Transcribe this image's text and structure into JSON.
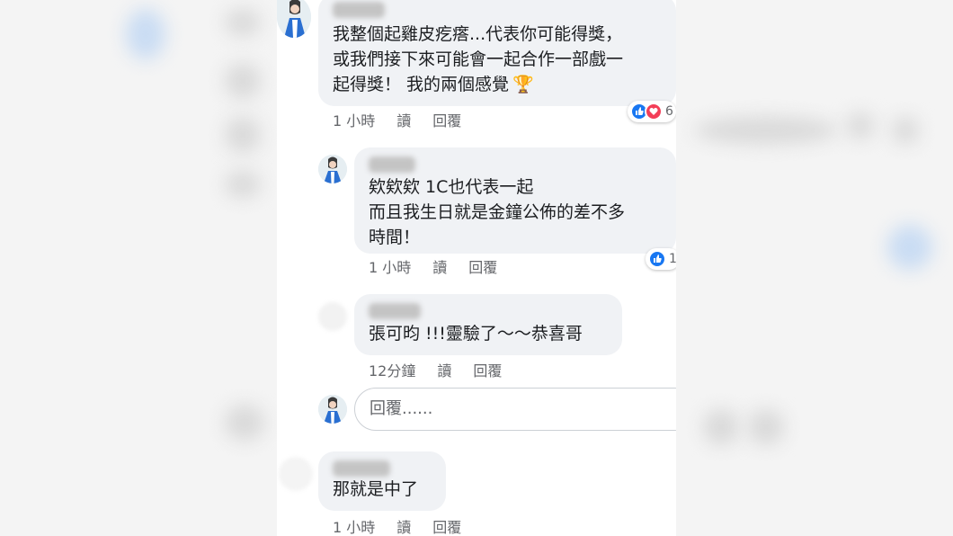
{
  "comments": [
    {
      "text_lines": [
        "我整個起雞皮疙瘩...代表你可能得獎，",
        "或我們接下來可能會一起合作一部戲一",
        "起得獎！ 我的兩個感覺"
      ],
      "trophy_emoji": "🏆",
      "time": "1 小時",
      "read": "讀",
      "reply": "回覆",
      "reaction_count": "6"
    },
    {
      "text_lines": [
        "欸欸欸 1C也代表一起",
        "而且我生日就是金鐘公佈的差不多",
        "時間！"
      ],
      "time": "1 小時",
      "read": "讀",
      "reply": "回覆",
      "reaction_count": "1"
    },
    {
      "text_lines": [
        "張可昀 !!!靈驗了～～恭喜哥"
      ],
      "time": "12分鐘",
      "read": "讀",
      "reply": "回覆"
    },
    {
      "text_lines": [
        "那就是中了"
      ],
      "time": "1 小時",
      "read": "讀",
      "reply": "回覆"
    }
  ],
  "reply_box": {
    "placeholder": "回覆......"
  },
  "colors": {
    "like": "#1877f2",
    "love": "#f33e58",
    "bubble": "#f0f2f5"
  }
}
